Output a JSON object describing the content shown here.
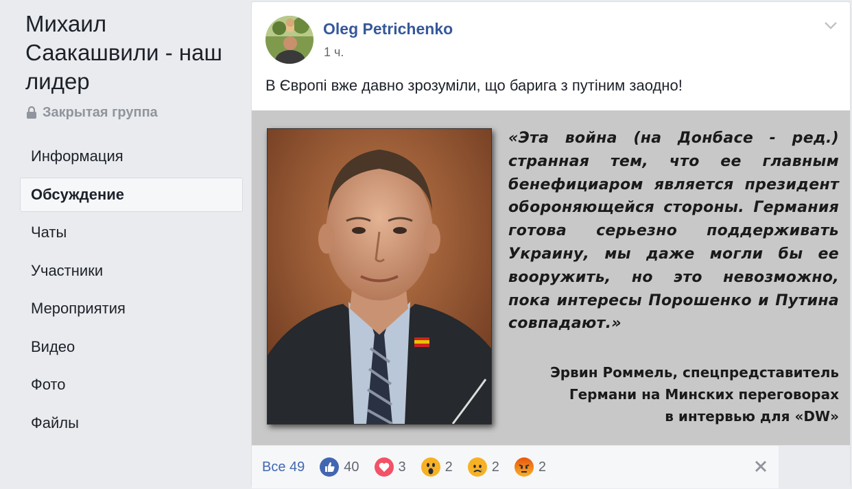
{
  "group": {
    "title": "Михаил Саакашвили - наш лидер",
    "privacy": "Закрытая группа",
    "nav": [
      {
        "label": "Информация",
        "active": false
      },
      {
        "label": "Обсуждение",
        "active": true
      },
      {
        "label": "Чаты",
        "active": false
      },
      {
        "label": "Участники",
        "active": false
      },
      {
        "label": "Мероприятия",
        "active": false
      },
      {
        "label": "Видео",
        "active": false
      },
      {
        "label": "Фото",
        "active": false
      },
      {
        "label": "Файлы",
        "active": false
      }
    ]
  },
  "post": {
    "author": "Oleg Petrichenko",
    "time": "1 ч.",
    "text": "В Європі вже давно зрозуміли, що барига з путіним заодно!",
    "image": {
      "quote": "«Эта война (на Донбасе - ред.) странная тем, что ее главным бенефициаром является президент обороняющейся стороны. Германия готова серьезно поддерживать Украину, мы даже могли бы ее вооружить, но это невозможно, пока интересы Порошенко и Путина совпадают.»",
      "attribution": [
        "Эрвин Роммель, спецпредставитель",
        "Германи на Минских переговорах",
        "в интервью для «DW»"
      ]
    }
  },
  "reactions": {
    "all_label": "Все 49",
    "items": [
      {
        "type": "like",
        "count": "40",
        "icon": "like-icon",
        "color": "#4267b2"
      },
      {
        "type": "love",
        "count": "3",
        "icon": "love-icon",
        "color": "#f25268"
      },
      {
        "type": "wow",
        "count": "2",
        "icon": "wow-icon",
        "color": "#f7b125"
      },
      {
        "type": "sad",
        "count": "2",
        "icon": "sad-icon",
        "color": "#f7b125"
      },
      {
        "type": "angry",
        "count": "2",
        "icon": "angry-icon",
        "color": "#e9710f"
      }
    ]
  },
  "colors": {
    "link": "#365899",
    "accent": "#4267b2",
    "background": "#e9ebee"
  }
}
